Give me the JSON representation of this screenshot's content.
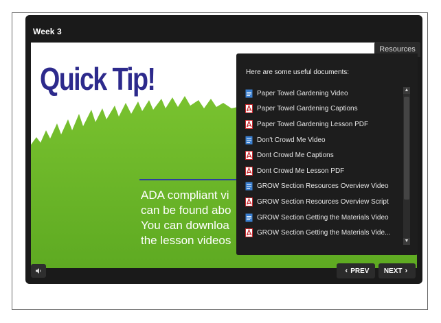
{
  "player": {
    "week_title": "Week 3"
  },
  "slide": {
    "heading": "Quick Tip!",
    "text_lines": [
      "ADA compliant vi",
      "can be found abo",
      "You can downloa",
      "the lesson videos"
    ]
  },
  "resources": {
    "tab_label": "Resources",
    "heading": "Here are some useful documents:",
    "items": [
      {
        "label": "Paper Towel Gardening Video",
        "icon": "document-icon"
      },
      {
        "label": "Paper Towel Gardening Captions",
        "icon": "pdf-icon"
      },
      {
        "label": "Paper Towel Gardening Lesson PDF",
        "icon": "pdf-icon"
      },
      {
        "label": "Don't Crowd Me Video",
        "icon": "document-icon"
      },
      {
        "label": "Dont Crowd Me Captions",
        "icon": "pdf-icon"
      },
      {
        "label": "Dont Crowd Me Lesson PDF",
        "icon": "pdf-icon"
      },
      {
        "label": "GROW Section Resources Overview Video",
        "icon": "document-icon"
      },
      {
        "label": "GROW Section Resources Overview Script",
        "icon": "pdf-icon"
      },
      {
        "label": "GROW Section Getting the Materials Video",
        "icon": "document-icon"
      },
      {
        "label": "GROW Section Getting the Materials Vide...",
        "icon": "pdf-icon"
      }
    ]
  },
  "controls": {
    "volume_icon": "speaker-icon",
    "prev_label": "PREV",
    "next_label": "NEXT"
  },
  "colors": {
    "heading_blue": "#2d2a8c",
    "grass_green": "#6fbd2a",
    "pdf_red": "#c8282d",
    "doc_blue": "#3a7fd0"
  }
}
